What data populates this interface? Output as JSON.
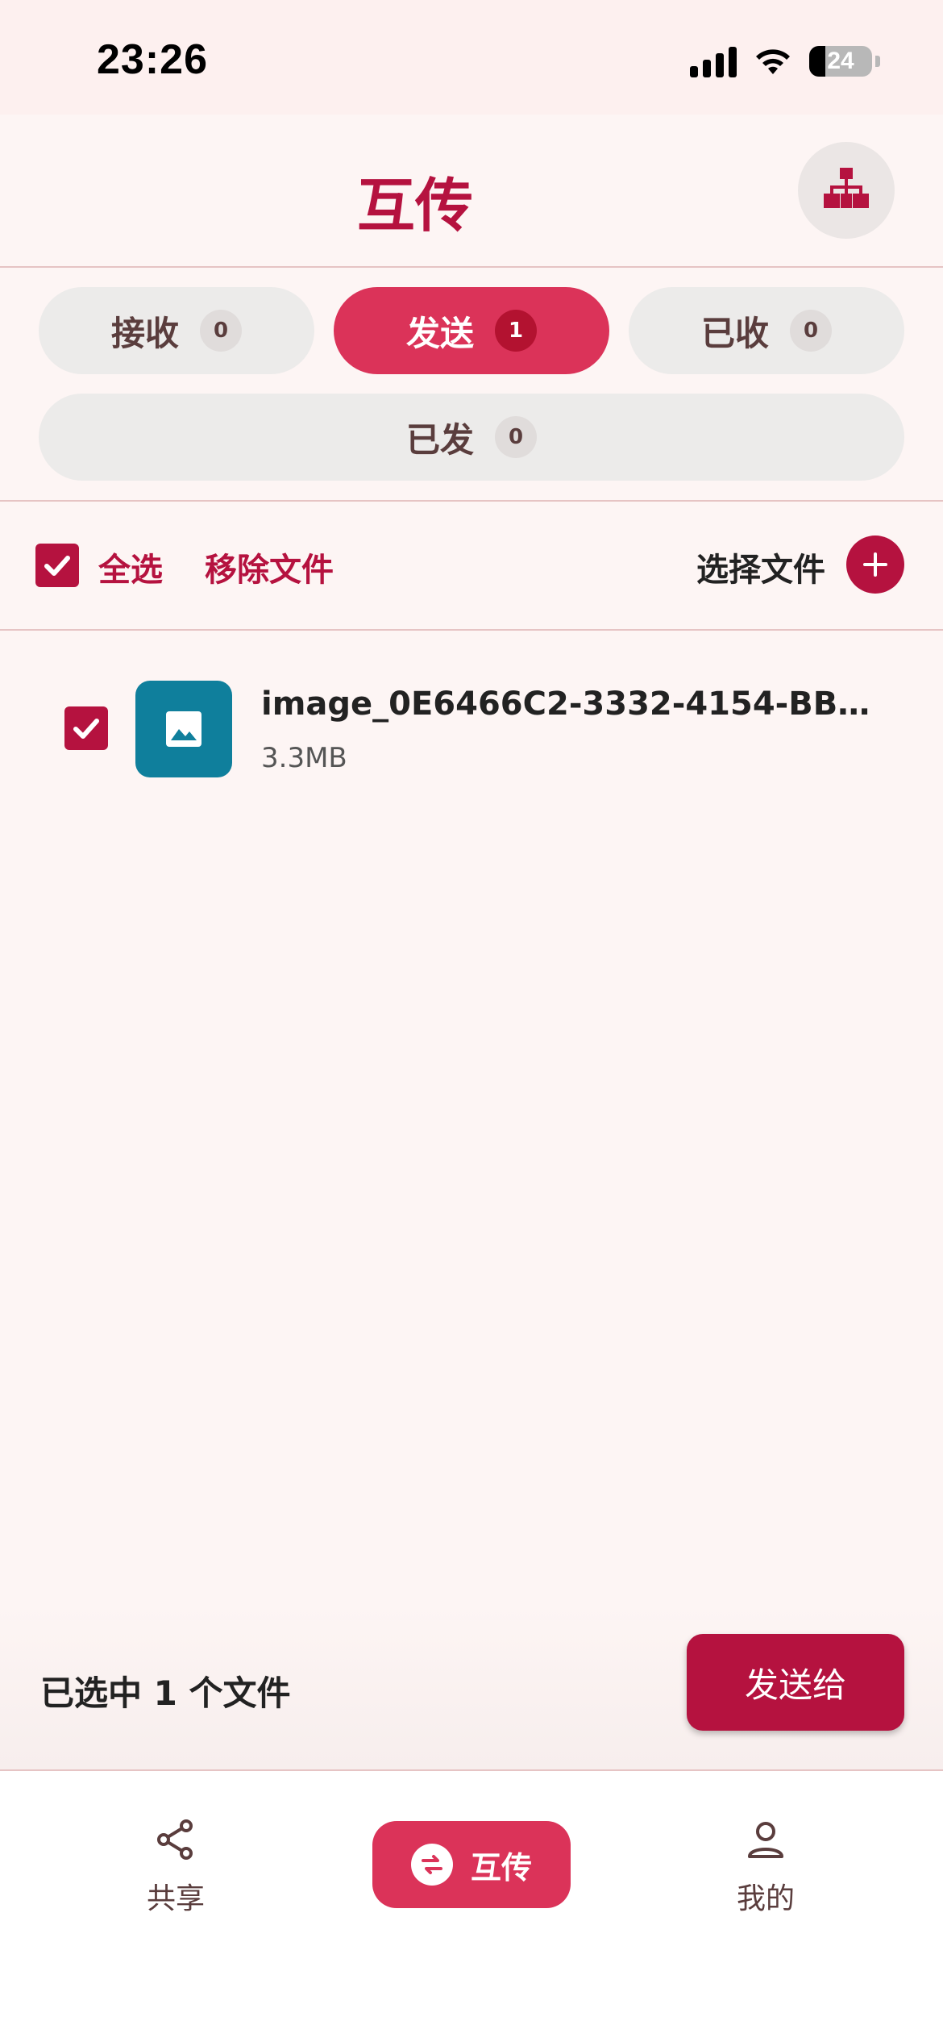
{
  "status_bar": {
    "time": "23:26",
    "battery": "24"
  },
  "header": {
    "title": "互传",
    "network_icon": "network-topology-icon"
  },
  "tabs": [
    {
      "label": "接收",
      "count": "0"
    },
    {
      "label": "发送",
      "count": "1",
      "active": true
    },
    {
      "label": "已收",
      "count": "0"
    },
    {
      "label": "已发",
      "count": "0"
    }
  ],
  "toolbar": {
    "select_all": "全选",
    "remove_files": "移除文件",
    "choose_files": "选择文件"
  },
  "files": [
    {
      "name": "image_0E6466C2-3332-4154-BBA7-...",
      "size": "3.3MB",
      "checked": true,
      "icon": "image-icon"
    }
  ],
  "footer": {
    "selected_text": "已选中 1 个文件",
    "send_to": "发送给"
  },
  "bottom_nav": {
    "share": "共享",
    "transfer": "互传",
    "mine": "我的"
  },
  "colors": {
    "brand": "#b5123f",
    "accent": "#db3359",
    "background": "#fdf5f4"
  }
}
